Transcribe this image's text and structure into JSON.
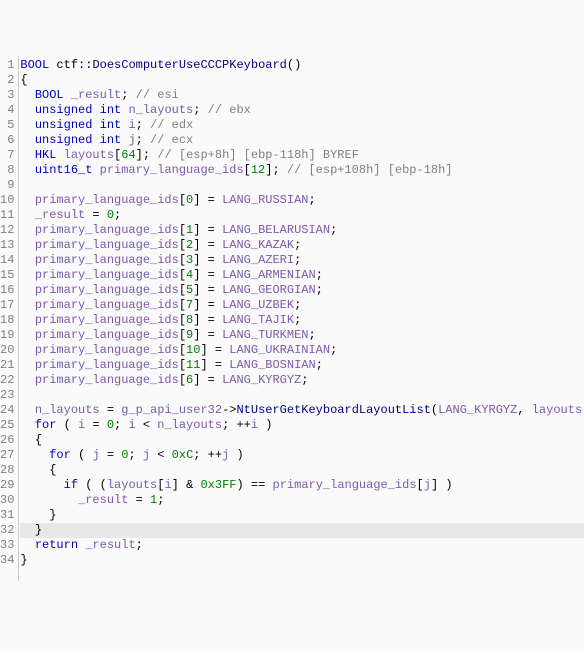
{
  "line_count": 34,
  "lines": [
    {
      "tokens": [
        [
          "type",
          "BOOL"
        ],
        [
          "black",
          " ctf"
        ],
        [
          "punct",
          "::"
        ],
        [
          "func",
          "DoesComputerUseCCCPKeyboard"
        ],
        [
          "punct",
          "()"
        ]
      ]
    },
    {
      "tokens": [
        [
          "punct",
          "{"
        ]
      ]
    },
    {
      "tokens": [
        [
          "black",
          "  "
        ],
        [
          "type",
          "BOOL"
        ],
        [
          "black",
          " "
        ],
        [
          "variable",
          "_result"
        ],
        [
          "punct",
          "; "
        ],
        [
          "comment",
          "// esi"
        ]
      ]
    },
    {
      "tokens": [
        [
          "black",
          "  "
        ],
        [
          "keyword",
          "unsigned int"
        ],
        [
          "black",
          " "
        ],
        [
          "variable",
          "n_layouts"
        ],
        [
          "punct",
          "; "
        ],
        [
          "comment",
          "// ebx"
        ]
      ]
    },
    {
      "tokens": [
        [
          "black",
          "  "
        ],
        [
          "keyword",
          "unsigned int"
        ],
        [
          "black",
          " "
        ],
        [
          "variable",
          "i"
        ],
        [
          "punct",
          "; "
        ],
        [
          "comment",
          "// edx"
        ]
      ]
    },
    {
      "tokens": [
        [
          "black",
          "  "
        ],
        [
          "keyword",
          "unsigned int"
        ],
        [
          "black",
          " "
        ],
        [
          "variable",
          "j"
        ],
        [
          "punct",
          "; "
        ],
        [
          "comment",
          "// ecx"
        ]
      ]
    },
    {
      "tokens": [
        [
          "black",
          "  "
        ],
        [
          "type",
          "HKL"
        ],
        [
          "black",
          " "
        ],
        [
          "variable",
          "layouts"
        ],
        [
          "punct",
          "["
        ],
        [
          "number",
          "64"
        ],
        [
          "punct",
          "]; "
        ],
        [
          "comment",
          "// [esp+8h] [ebp-118h] BYREF"
        ]
      ]
    },
    {
      "tokens": [
        [
          "black",
          "  "
        ],
        [
          "type",
          "uint16_t"
        ],
        [
          "black",
          " "
        ],
        [
          "variable",
          "primary_language_ids"
        ],
        [
          "punct",
          "["
        ],
        [
          "number",
          "12"
        ],
        [
          "punct",
          "]; "
        ],
        [
          "comment",
          "// [esp+108h] [ebp-18h]"
        ]
      ]
    },
    {
      "tokens": []
    },
    {
      "tokens": [
        [
          "black",
          "  "
        ],
        [
          "variable",
          "primary_language_ids"
        ],
        [
          "punct",
          "["
        ],
        [
          "number",
          "0"
        ],
        [
          "punct",
          "] = "
        ],
        [
          "macro",
          "LANG_RUSSIAN"
        ],
        [
          "punct",
          ";"
        ]
      ]
    },
    {
      "tokens": [
        [
          "black",
          "  "
        ],
        [
          "variable",
          "_result"
        ],
        [
          "punct",
          " = "
        ],
        [
          "number",
          "0"
        ],
        [
          "punct",
          ";"
        ]
      ]
    },
    {
      "tokens": [
        [
          "black",
          "  "
        ],
        [
          "variable",
          "primary_language_ids"
        ],
        [
          "punct",
          "["
        ],
        [
          "number",
          "1"
        ],
        [
          "punct",
          "] = "
        ],
        [
          "macro",
          "LANG_BELARUSIAN"
        ],
        [
          "punct",
          ";"
        ]
      ]
    },
    {
      "tokens": [
        [
          "black",
          "  "
        ],
        [
          "variable",
          "primary_language_ids"
        ],
        [
          "punct",
          "["
        ],
        [
          "number",
          "2"
        ],
        [
          "punct",
          "] = "
        ],
        [
          "macro",
          "LANG_KAZAK"
        ],
        [
          "punct",
          ";"
        ]
      ]
    },
    {
      "tokens": [
        [
          "black",
          "  "
        ],
        [
          "variable",
          "primary_language_ids"
        ],
        [
          "punct",
          "["
        ],
        [
          "number",
          "3"
        ],
        [
          "punct",
          "] = "
        ],
        [
          "macro",
          "LANG_AZERI"
        ],
        [
          "punct",
          ";"
        ]
      ]
    },
    {
      "tokens": [
        [
          "black",
          "  "
        ],
        [
          "variable",
          "primary_language_ids"
        ],
        [
          "punct",
          "["
        ],
        [
          "number",
          "4"
        ],
        [
          "punct",
          "] = "
        ],
        [
          "macro",
          "LANG_ARMENIAN"
        ],
        [
          "punct",
          ";"
        ]
      ]
    },
    {
      "tokens": [
        [
          "black",
          "  "
        ],
        [
          "variable",
          "primary_language_ids"
        ],
        [
          "punct",
          "["
        ],
        [
          "number",
          "5"
        ],
        [
          "punct",
          "] = "
        ],
        [
          "macro",
          "LANG_GEORGIAN"
        ],
        [
          "punct",
          ";"
        ]
      ]
    },
    {
      "tokens": [
        [
          "black",
          "  "
        ],
        [
          "variable",
          "primary_language_ids"
        ],
        [
          "punct",
          "["
        ],
        [
          "number",
          "7"
        ],
        [
          "punct",
          "] = "
        ],
        [
          "macro",
          "LANG_UZBEK"
        ],
        [
          "punct",
          ";"
        ]
      ]
    },
    {
      "tokens": [
        [
          "black",
          "  "
        ],
        [
          "variable",
          "primary_language_ids"
        ],
        [
          "punct",
          "["
        ],
        [
          "number",
          "8"
        ],
        [
          "punct",
          "] = "
        ],
        [
          "macro",
          "LANG_TAJIK"
        ],
        [
          "punct",
          ";"
        ]
      ]
    },
    {
      "tokens": [
        [
          "black",
          "  "
        ],
        [
          "variable",
          "primary_language_ids"
        ],
        [
          "punct",
          "["
        ],
        [
          "number",
          "9"
        ],
        [
          "punct",
          "] = "
        ],
        [
          "macro",
          "LANG_TURKMEN"
        ],
        [
          "punct",
          ";"
        ]
      ]
    },
    {
      "tokens": [
        [
          "black",
          "  "
        ],
        [
          "variable",
          "primary_language_ids"
        ],
        [
          "punct",
          "["
        ],
        [
          "number",
          "10"
        ],
        [
          "punct",
          "] = "
        ],
        [
          "macro",
          "LANG_UKRAINIAN"
        ],
        [
          "punct",
          ";"
        ]
      ]
    },
    {
      "tokens": [
        [
          "black",
          "  "
        ],
        [
          "variable",
          "primary_language_ids"
        ],
        [
          "punct",
          "["
        ],
        [
          "number",
          "11"
        ],
        [
          "punct",
          "] = "
        ],
        [
          "macro",
          "LANG_BOSNIAN"
        ],
        [
          "punct",
          ";"
        ]
      ]
    },
    {
      "tokens": [
        [
          "black",
          "  "
        ],
        [
          "variable",
          "primary_language_ids"
        ],
        [
          "punct",
          "["
        ],
        [
          "number",
          "6"
        ],
        [
          "punct",
          "] = "
        ],
        [
          "macro",
          "LANG_KYRGYZ"
        ],
        [
          "punct",
          ";"
        ]
      ]
    },
    {
      "tokens": []
    },
    {
      "tokens": [
        [
          "black",
          "  "
        ],
        [
          "variable",
          "n_layouts"
        ],
        [
          "punct",
          " = "
        ],
        [
          "variable",
          "g_p_api_user32"
        ],
        [
          "punct",
          "->"
        ],
        [
          "func",
          "NtUserGetKeyboardLayoutList"
        ],
        [
          "punct",
          "("
        ],
        [
          "macro",
          "LANG_KYRGYZ"
        ],
        [
          "punct",
          ", "
        ],
        [
          "variable",
          "layouts"
        ],
        [
          "punct",
          ");"
        ]
      ]
    },
    {
      "tokens": [
        [
          "black",
          "  "
        ],
        [
          "keyword",
          "for"
        ],
        [
          "punct",
          " ( "
        ],
        [
          "variable",
          "i"
        ],
        [
          "punct",
          " = "
        ],
        [
          "number",
          "0"
        ],
        [
          "punct",
          "; "
        ],
        [
          "variable",
          "i"
        ],
        [
          "punct",
          " < "
        ],
        [
          "variable",
          "n_layouts"
        ],
        [
          "punct",
          "; ++"
        ],
        [
          "variable",
          "i"
        ],
        [
          "punct",
          " )"
        ]
      ]
    },
    {
      "tokens": [
        [
          "black",
          "  "
        ],
        [
          "punct",
          "{"
        ]
      ]
    },
    {
      "tokens": [
        [
          "black",
          "    "
        ],
        [
          "keyword",
          "for"
        ],
        [
          "punct",
          " ( "
        ],
        [
          "variable",
          "j"
        ],
        [
          "punct",
          " = "
        ],
        [
          "number",
          "0"
        ],
        [
          "punct",
          "; "
        ],
        [
          "variable",
          "j"
        ],
        [
          "punct",
          " < "
        ],
        [
          "number",
          "0xC"
        ],
        [
          "punct",
          "; ++"
        ],
        [
          "variable",
          "j"
        ],
        [
          "punct",
          " )"
        ]
      ]
    },
    {
      "tokens": [
        [
          "black",
          "    "
        ],
        [
          "punct",
          "{"
        ]
      ]
    },
    {
      "tokens": [
        [
          "black",
          "      "
        ],
        [
          "keyword",
          "if"
        ],
        [
          "punct",
          " ( ("
        ],
        [
          "variable",
          "layouts"
        ],
        [
          "punct",
          "["
        ],
        [
          "variable",
          "i"
        ],
        [
          "punct",
          "] & "
        ],
        [
          "number",
          "0x3FF"
        ],
        [
          "punct",
          ") == "
        ],
        [
          "variable",
          "primary_language_ids"
        ],
        [
          "punct",
          "["
        ],
        [
          "variable",
          "j"
        ],
        [
          "punct",
          "] )"
        ]
      ]
    },
    {
      "tokens": [
        [
          "black",
          "        "
        ],
        [
          "variable",
          "_result"
        ],
        [
          "punct",
          " = "
        ],
        [
          "number",
          "1"
        ],
        [
          "punct",
          ";"
        ]
      ]
    },
    {
      "tokens": [
        [
          "black",
          "    "
        ],
        [
          "punct",
          "}"
        ]
      ]
    },
    {
      "tokens": [
        [
          "black",
          "  "
        ],
        [
          "punct",
          "}"
        ]
      ],
      "highlighted": true
    },
    {
      "tokens": [
        [
          "black",
          "  "
        ],
        [
          "keyword",
          "return"
        ],
        [
          "black",
          " "
        ],
        [
          "variable",
          "_result"
        ],
        [
          "punct",
          ";"
        ]
      ]
    },
    {
      "tokens": [
        [
          "punct",
          "}"
        ]
      ]
    }
  ]
}
